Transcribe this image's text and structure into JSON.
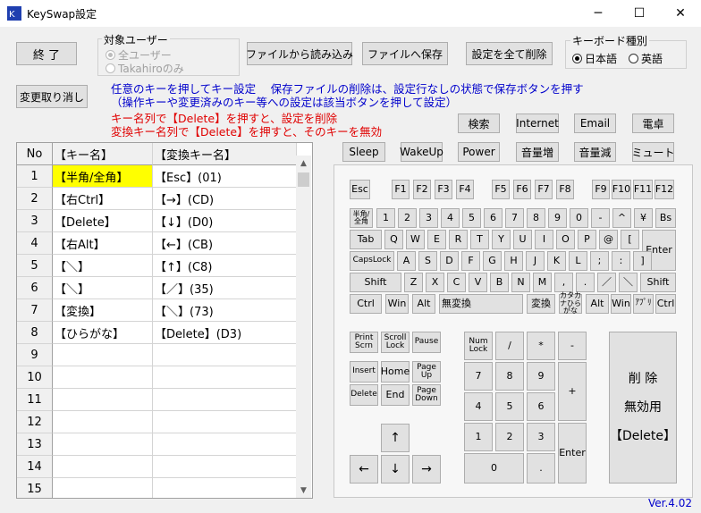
{
  "window": {
    "title": "KeySwap設定",
    "minimize": "─",
    "maximize": "☐",
    "close": "✕"
  },
  "toolbar": {
    "exit": "終 了",
    "undo": "変更取り消し",
    "load": "ファイルから読み込み",
    "save": "ファイルへ保存",
    "delete_all": "設定を全て削除"
  },
  "target_user": {
    "label": "対象ユーザー",
    "all": "全ユーザー",
    "only": "Takahiroのみ",
    "selected": "all"
  },
  "keyboard_type": {
    "label": "キーボード種別",
    "jp": "日本語",
    "en": "英語",
    "selected": "jp"
  },
  "info": {
    "line1": "任意のキーを押してキー設定　 保存ファイルの削除は、設定行なしの状態で保存ボタンを押す",
    "line2": "（操作キーや変更済みのキー等への設定は該当ボタンを押して設定）",
    "line3": "キー名列で【Delete】を押すと、設定を削除",
    "line4": "変換キー名列で【Delete】を押すと、そのキーを無効"
  },
  "special_keys": {
    "search": "検索",
    "internet": "Internet",
    "email": "Email",
    "calc": "電卓",
    "sleep": "Sleep",
    "wakeup": "WakeUp",
    "power": "Power",
    "vol_up": "音量増",
    "vol_down": "音量減",
    "mute": "ミュート"
  },
  "grid": {
    "headers": [
      "No",
      "【キー名】",
      "【変換キー名】"
    ],
    "rows": [
      [
        "1",
        "【半角/全角】",
        "【Esc】(01)"
      ],
      [
        "2",
        "【右Ctrl】",
        "【→】(CD)"
      ],
      [
        "3",
        "【Delete】",
        "【↓】(D0)"
      ],
      [
        "4",
        "【右Alt】",
        "【←】(CB)"
      ],
      [
        "5",
        "【＼】",
        "【↑】(C8)"
      ],
      [
        "6",
        "【＼】",
        "【／】(35)"
      ],
      [
        "7",
        "【変換】",
        "【＼】(73)"
      ],
      [
        "8",
        "【ひらがな】",
        "【Delete】(D3)"
      ],
      [
        "9",
        "",
        ""
      ],
      [
        "10",
        "",
        ""
      ],
      [
        "11",
        "",
        ""
      ],
      [
        "12",
        "",
        ""
      ],
      [
        "13",
        "",
        ""
      ],
      [
        "14",
        "",
        ""
      ],
      [
        "15",
        "",
        ""
      ]
    ]
  },
  "keyboard": {
    "esc": "Esc",
    "f1": "F1",
    "f2": "F2",
    "f3": "F3",
    "f4": "F4",
    "f5": "F5",
    "f6": "F6",
    "f7": "F7",
    "f8": "F8",
    "f9": "F9",
    "f10": "F10",
    "f11": "F11",
    "f12": "F12",
    "hankaku": "半角/全角",
    "n1": "1",
    "n2": "2",
    "n3": "3",
    "n4": "4",
    "n5": "5",
    "n6": "6",
    "n7": "7",
    "n8": "8",
    "n9": "9",
    "n0": "0",
    "minus": "-",
    "caret": "^",
    "yen": "¥",
    "bs": "Bs",
    "tab": "Tab",
    "q": "Q",
    "w": "W",
    "e": "E",
    "r": "R",
    "t": "T",
    "y": "Y",
    "u": "U",
    "i": "I",
    "o": "O",
    "p": "P",
    "at": "@",
    "lbracket": "[",
    "enter": "Enter",
    "capslock": "CapsLock",
    "a": "A",
    "s": "S",
    "d": "D",
    "f": "F",
    "g": "G",
    "h": "H",
    "j": "J",
    "k": "K",
    "l": "L",
    "semicolon": ";",
    "colon": ":",
    "rbracket": "]",
    "lshift": "Shift",
    "z": "Z",
    "x": "X",
    "c": "C",
    "v": "V",
    "b": "B",
    "n": "N",
    "m": "M",
    "comma": ",",
    "period": ".",
    "slash": "／",
    "backslash": "＼",
    "rshift": "Shift",
    "lctrl": "Ctrl",
    "lwin": "Win",
    "lalt": "Alt",
    "muhenkan": "無変換",
    "henkan": "変換",
    "kana": "カタカナひらがな",
    "ralt": "Alt",
    "rwin": "Win",
    "app": "ｱﾌﾟﾘ",
    "rctrl": "Ctrl",
    "printscrn": "Print Scrn",
    "scrolllock": "Scroll Lock",
    "pause": "Pause",
    "insert": "Insert",
    "home": "Home",
    "pageup": "Page Up",
    "delete": "Delete",
    "end": "End",
    "pagedown": "Page Down",
    "up": "↑",
    "left": "←",
    "down": "↓",
    "right": "→",
    "numlock": "Num Lock",
    "np_div": "/",
    "np_mul": "*",
    "np_sub": "-",
    "np7": "7",
    "np8": "8",
    "np9": "9",
    "np_add": "+",
    "np4": "4",
    "np5": "5",
    "np6": "6",
    "np1": "1",
    "np2": "2",
    "np3": "3",
    "np_enter": "Enter",
    "np0": "0",
    "np_dot": "."
  },
  "delete_disable": {
    "line1": "削 除",
    "line2": "無効用",
    "line3": "【Delete】"
  },
  "version": "Ver.4.02"
}
